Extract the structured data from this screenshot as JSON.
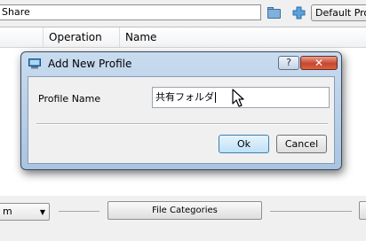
{
  "background": {
    "path_value": "Share",
    "profile_select": "Default Profile",
    "columns": [
      "Operation",
      "Name"
    ],
    "combo_value": "m",
    "file_categories_label": "File Categories"
  },
  "dialog": {
    "title": "Add New Profile",
    "help_label": "?",
    "close_label": "✕",
    "profile_name_label": "Profile Name",
    "profile_name_value": "共有フォルダ",
    "ok_label": "Ok",
    "cancel_label": "Cancel"
  }
}
